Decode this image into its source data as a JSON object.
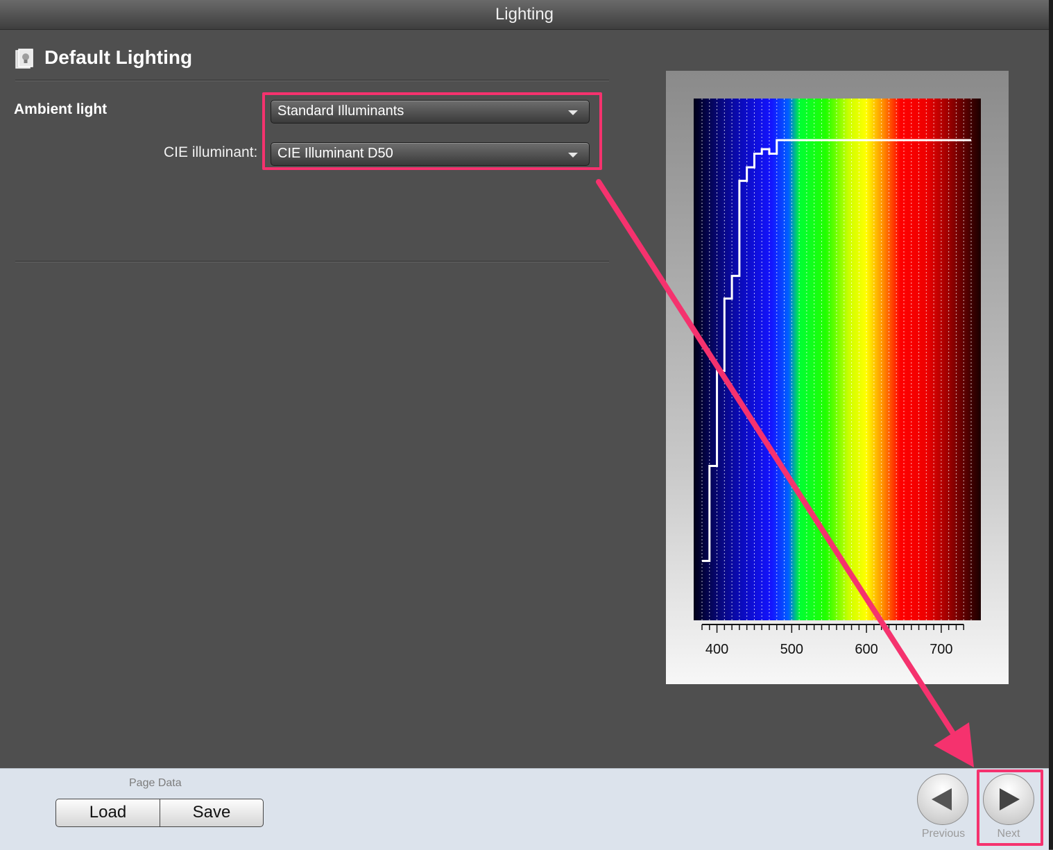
{
  "window": {
    "title": "Lighting"
  },
  "section": {
    "title": "Default Lighting",
    "icon": "lightbulb-document-icon"
  },
  "ambient": {
    "label": "Ambient light",
    "dropdown_value": "Standard Illuminants"
  },
  "illuminant": {
    "label": "CIE illuminant:",
    "dropdown_value": "CIE Illuminant D50"
  },
  "chart_data": {
    "type": "line",
    "title": "",
    "xlabel": "",
    "ylabel": "",
    "xlim": [
      380,
      740
    ],
    "ylim": [
      0,
      1
    ],
    "x_ticks": [
      400,
      500,
      600,
      700
    ],
    "x": [
      380,
      390,
      400,
      410,
      420,
      430,
      440,
      450,
      460,
      470,
      480,
      490,
      500,
      510,
      520,
      530,
      540,
      550,
      560,
      570,
      580,
      590,
      600,
      610,
      620,
      630,
      640,
      650,
      660,
      670,
      680,
      690,
      700,
      710,
      720,
      730
    ],
    "series": [
      {
        "values": [
          0.07,
          0.28,
          0.49,
          0.65,
          0.7,
          0.91,
          0.94,
          0.97,
          0.98,
          0.97,
          1.0,
          1.0,
          1.0,
          1.0,
          1.0,
          1.0,
          1.0,
          1.0,
          1.0,
          1.0,
          1.0,
          1.0,
          1.0,
          1.0,
          1.0,
          1.0,
          1.0,
          1.0,
          1.0,
          1.0,
          1.0,
          1.0,
          1.0,
          1.0,
          1.0,
          1.0
        ]
      }
    ]
  },
  "footer": {
    "page_data_label": "Page Data",
    "load_label": "Load",
    "save_label": "Save",
    "previous_label": "Previous",
    "next_label": "Next"
  }
}
